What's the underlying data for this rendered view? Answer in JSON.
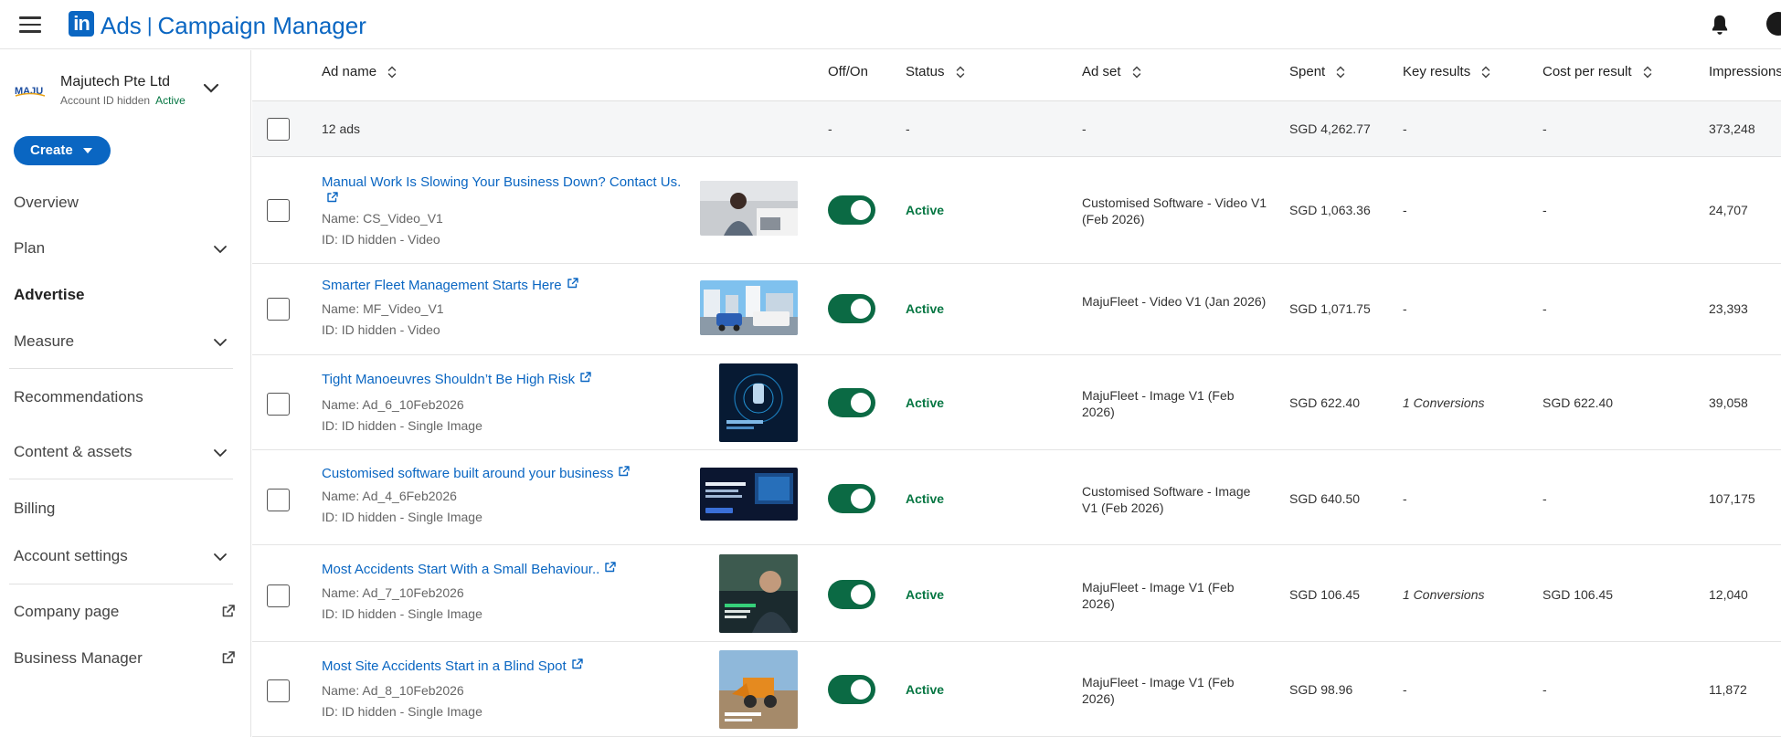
{
  "header": {
    "brand_ads": "Ads",
    "brand_product": "Campaign Manager",
    "logo_text": "in",
    "icons": {
      "menu": "hamburger-icon",
      "notifications": "bell-icon"
    }
  },
  "account": {
    "name": "Majutech Pte Ltd",
    "id_text": "Account ID hidden",
    "status": "Active",
    "logo_text": "MAJU"
  },
  "sidebar": {
    "create_label": "Create",
    "items": [
      {
        "label": "Overview"
      },
      {
        "label": "Plan"
      },
      {
        "label": "Advertise"
      },
      {
        "label": "Measure"
      },
      {
        "label": "Recommendations"
      },
      {
        "label": "Content & assets"
      },
      {
        "label": "Billing"
      },
      {
        "label": "Account settings"
      },
      {
        "label": "Company page"
      },
      {
        "label": "Business Manager"
      }
    ]
  },
  "table": {
    "columns": {
      "ad_name": "Ad name",
      "off_on": "Off/On",
      "status": "Status",
      "ad_set": "Ad set",
      "spent": "Spent",
      "key_results": "Key results",
      "cost_per_result": "Cost per result",
      "impressions": "Impressions"
    },
    "summary": {
      "label": "12 ads",
      "off_on": "-",
      "status": "-",
      "ad_set": "-",
      "spent": "SGD 4,262.77",
      "key_results": "-",
      "cost_per_result": "-",
      "impressions": "373,248"
    },
    "rows": [
      {
        "title": "Manual Work Is Slowing Your Business Down? Contact Us.",
        "name": "Name: CS_Video_V1",
        "id": "ID: ID hidden - Video",
        "status": "Active",
        "ad_set": "Customised Software - Video V1 (Feb 2026)",
        "spent": "SGD 1,063.36",
        "key_results": "-",
        "cost_per_result": "-",
        "impressions": "24,707"
      },
      {
        "title": "Smarter Fleet Management Starts Here",
        "name": "Name: MF_Video_V1",
        "id": "ID: ID hidden - Video",
        "status": "Active",
        "ad_set": "MajuFleet - Video V1 (Jan 2026)",
        "spent": "SGD 1,071.75",
        "key_results": "-",
        "cost_per_result": "-",
        "impressions": "23,393"
      },
      {
        "title": "Tight Manoeuvres Shouldn’t Be High Risk",
        "name": "Name: Ad_6_10Feb2026",
        "id": "ID: ID hidden - Single Image",
        "status": "Active",
        "ad_set": "MajuFleet - Image V1 (Feb 2026)",
        "spent": "SGD 622.40",
        "key_results": "1 Conversions",
        "cost_per_result": "SGD 622.40",
        "impressions": "39,058"
      },
      {
        "title": "Customised software built around your business",
        "name": "Name: Ad_4_6Feb2026",
        "id": "ID: ID hidden - Single Image",
        "status": "Active",
        "ad_set": "Customised Software - Image V1 (Feb 2026)",
        "spent": "SGD 640.50",
        "key_results": "-",
        "cost_per_result": "-",
        "impressions": "107,175"
      },
      {
        "title": "Most Accidents Start With a Small Behaviour..",
        "name": "Name: Ad_7_10Feb2026",
        "id": "ID: ID hidden - Single Image",
        "status": "Active",
        "ad_set": "MajuFleet - Image V1 (Feb 2026)",
        "spent": "SGD 106.45",
        "key_results": "1 Conversions",
        "cost_per_result": "SGD 106.45",
        "impressions": "12,040"
      },
      {
        "title": "Most Site Accidents Start in a Blind Spot",
        "name": "Name: Ad_8_10Feb2026",
        "id": "ID: ID hidden - Single Image",
        "status": "Active",
        "ad_set": "MajuFleet - Image V1 (Feb 2026)",
        "spent": "SGD 98.96",
        "key_results": "-",
        "cost_per_result": "-",
        "impressions": "11,872"
      }
    ]
  },
  "colors": {
    "brand_blue": "#0a66c2",
    "active_green": "#057642",
    "toggle_green": "#0b6a44"
  }
}
